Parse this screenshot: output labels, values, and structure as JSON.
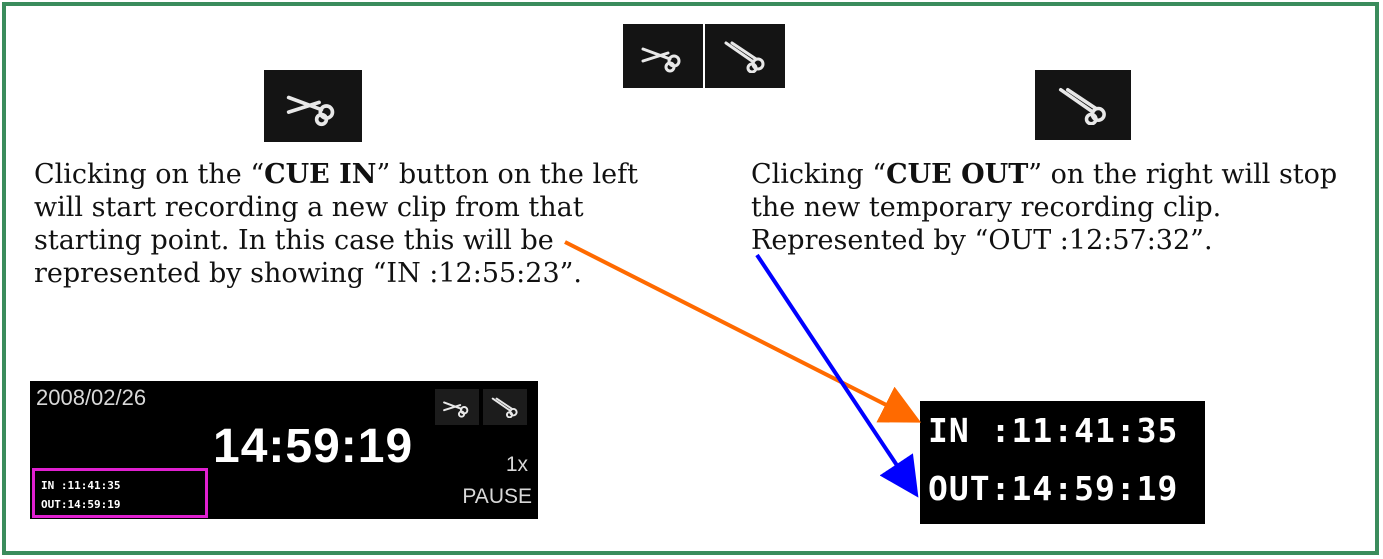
{
  "icons": {
    "cue_in": "scissors-cue-in-icon",
    "cue_out": "scissors-cue-out-icon"
  },
  "left_text": {
    "prefix": "Clicking on the “",
    "bold": "CUE IN",
    "suffix": "” button on the left will start recording a new clip from that starting point. In this case this will be represented by showing “IN :12:55:23”."
  },
  "right_text": {
    "prefix": "Clicking “",
    "bold": "CUE OUT",
    "suffix": "” on the right will stop the new temporary recording clip. Represented by “OUT :12:57:32”."
  },
  "player": {
    "date": "2008/02/26",
    "time": "14:59:19",
    "speed": "1x",
    "status": "PAUSE",
    "in_label": "IN :11:41:35",
    "out_label": "OUT:14:59:19"
  },
  "timecode": {
    "in": "IN :11:41:35",
    "out": "OUT:14:59:19"
  },
  "colors": {
    "frame": "#3a8c5c",
    "highlight": "#e020d0",
    "arrow_in": "#ff6a00",
    "arrow_out": "#0000ff"
  }
}
